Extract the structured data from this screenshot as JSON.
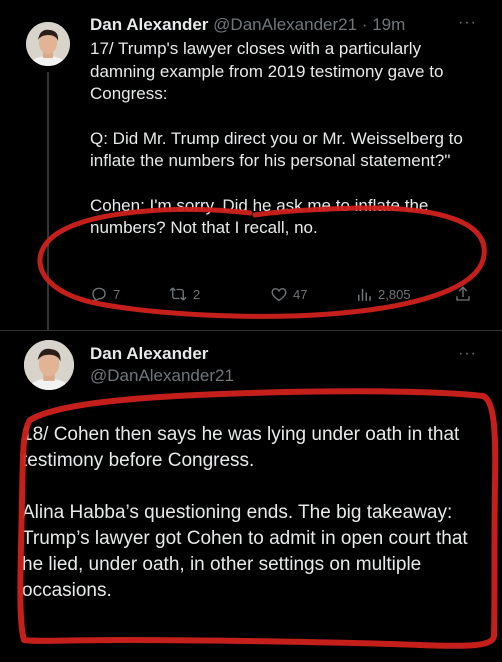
{
  "tweet1": {
    "author": {
      "name": "Dan Alexander",
      "handle": "@DanAlexander21",
      "separator": "·",
      "time": "19m"
    },
    "text": {
      "p1": "17/ Trump's lawyer closes with a particularly damning example from 2019 testimony gave to Congress:",
      "p2": "Q: Did Mr. Trump direct you or Mr. Weisselberg to inflate the numbers for his personal statement?\"",
      "p3": "Cohen: I'm sorry. Did he ask me to inflate the numbers? Not that I recall, no."
    },
    "stats": {
      "replies": "7",
      "retweets": "2",
      "likes": "47",
      "views": "2,805"
    },
    "more_label": "···"
  },
  "tweet2": {
    "author": {
      "name": "Dan Alexander",
      "handle": "@DanAlexander21"
    },
    "text": {
      "p1": "18/ Cohen then says he was lying under oath in that testimony before Congress.",
      "p2": "Alina Habba’s questioning ends. The big takeaway: Trump’s lawyer got Cohen to admit in open court that he lied, under oath, in other settings on multiple occasions."
    },
    "more_label": "···"
  },
  "icons": {
    "reply": "reply-icon",
    "retweet": "retweet-icon",
    "like": "heart-icon",
    "views": "views-icon",
    "share": "share-icon"
  },
  "colors": {
    "background": "#000000",
    "text": "#e7e9ea",
    "muted": "#71767b",
    "annotation": "#d0211c"
  }
}
